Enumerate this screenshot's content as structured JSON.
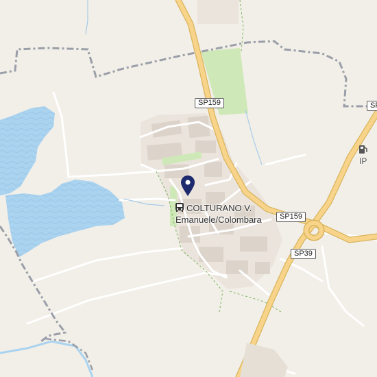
{
  "map": {
    "road_shields": [
      "SP159",
      "SP159",
      "SP159",
      "SP39"
    ],
    "place_label_line1": "COLTURANO V.",
    "place_label_line2": "Emanuele/Colombara",
    "fuel_label": "IP",
    "icons": {
      "pin": "location-pin-icon",
      "bus": "bus-stop-icon",
      "fuel": "fuel-station-icon"
    },
    "colors": {
      "background": "#f2efe8",
      "water": "#aad3f0",
      "highway": "#f7d48a",
      "highway_casing": "#d9b45c",
      "boundary": "#9a9ea8",
      "park": "#cfe8b8",
      "pin": "#1e2a6e"
    }
  }
}
